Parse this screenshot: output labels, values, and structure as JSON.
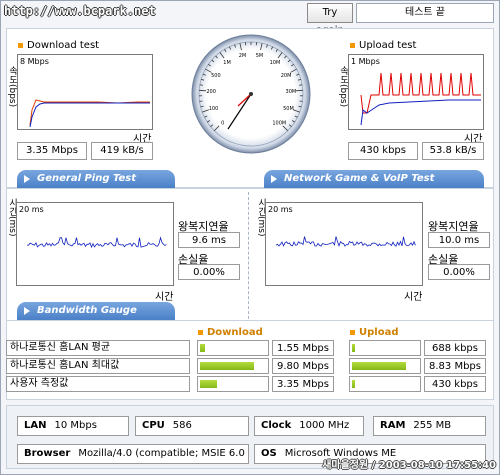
{
  "site": "http://www.bcpark.net",
  "controls": {
    "try_again": "Try again",
    "status": "테스트 끝"
  },
  "download": {
    "title": "Download test",
    "ylabel": "속도(bps)",
    "scale": "8 Mbps",
    "xlabel": "시간",
    "mbps": "3.35 Mbps",
    "kbs": "419 kB/s"
  },
  "upload": {
    "title": "Upload test",
    "ylabel": "속도(bps)",
    "scale": "1 Mbps",
    "xlabel": "시간",
    "kbps": "430 kbps",
    "kbs": "53.8 kB/s"
  },
  "gauge": {
    "ticks": [
      "0",
      "100",
      "200",
      "500",
      "1M",
      "2M",
      "5M",
      "10M",
      "20M",
      "30M",
      "50M",
      "100M"
    ]
  },
  "tabs": {
    "ping": "General Ping Test",
    "game": "Network Game & VoIP Test",
    "bandwidth": "Bandwidth Gauge"
  },
  "ping": {
    "ylabel": "시간(ms)",
    "scale": "20 ms",
    "xlabel": "시간",
    "rtt_label": "왕복지연율",
    "rtt": "9.6 ms",
    "loss_label": "손실율",
    "loss": "0.00%"
  },
  "game": {
    "ylabel": "시간(ms)",
    "scale": "20 ms",
    "xlabel": "시간",
    "rtt_label": "왕복지연율",
    "rtt": "10.0 ms",
    "loss_label": "손실율",
    "loss": "0.00%"
  },
  "bandwidth": {
    "download_title": "Download",
    "upload_title": "Upload",
    "rows": [
      {
        "label": "하나로통신 홈LAN 평균",
        "down": "1.55 Mbps",
        "down_fill": 0.07,
        "up": "688 kbps",
        "up_fill": 0.05
      },
      {
        "label": "하나로통신 홈LAN 최대값",
        "down": "9.80 Mbps",
        "down_fill": 0.8,
        "up": "8.83 Mbps",
        "up_fill": 0.8
      },
      {
        "label": "사용자 측정값",
        "down": "3.35 Mbps",
        "down_fill": 0.25,
        "up": "430 kbps",
        "up_fill": 0.05
      }
    ]
  },
  "system": {
    "lan_label": "LAN",
    "lan": "10 Mbps",
    "cpu_label": "CPU",
    "cpu": "586",
    "clock_label": "Clock",
    "clock": "1000 MHz",
    "ram_label": "RAM",
    "ram": "255 MB",
    "browser_label": "Browser",
    "browser": "Mozilla/4.0 (compatible; MSIE 6.0",
    "os_label": "OS",
    "os": "Microsoft Windows ME"
  },
  "watermark": "새마을정원 / 2003-08-10 17:55:40",
  "colors": {
    "accent": "#f39800",
    "tab": "#4a80c8",
    "bar": "#9ccc2a",
    "red": "#e00000",
    "blue": "#1020c0"
  }
}
